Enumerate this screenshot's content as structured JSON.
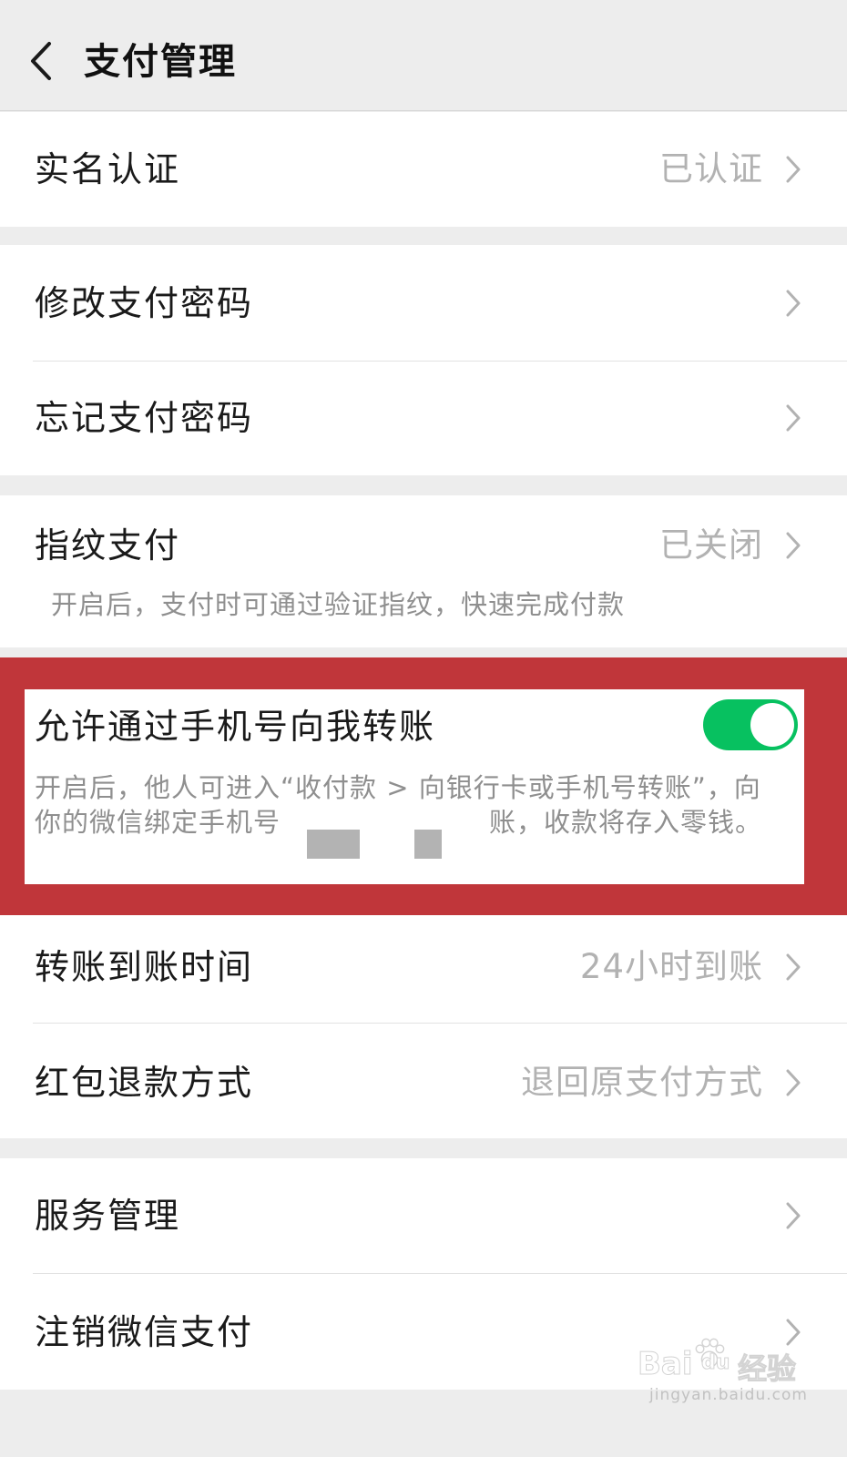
{
  "header": {
    "title": "支付管理",
    "back_icon": "chevron-left-icon"
  },
  "colors": {
    "accent_green": "#07c160",
    "highlight_red": "#c0363a",
    "background": "#ededed",
    "muted_text": "#b2b2b2"
  },
  "groups": {
    "realname": {
      "label": "实名认证",
      "value": "已认证"
    },
    "password": {
      "change_label": "修改支付密码",
      "forgot_label": "忘记支付密码"
    },
    "fingerprint": {
      "label": "指纹支付",
      "value": "已关闭",
      "description": "开启后，支付时可通过验证指纹，快速完成付款"
    },
    "phone_transfer": {
      "label": "允许通过手机号向我转账",
      "enabled": true,
      "description_line1": "开启后，他人可进入“收付款 > 向银行卡或手机号转账”，向",
      "description_line2_start": "你的微信绑定手机号",
      "description_line2_end": "账，收款将存入零钱。"
    },
    "transfer_settings": {
      "arrival_label": "转账到账时间",
      "arrival_value": "24小时到账",
      "refund_label": "红包退款方式",
      "refund_value": "退回原支付方式"
    },
    "services": {
      "service_label": "服务管理",
      "cancel_label": "注销微信支付"
    }
  },
  "watermark": {
    "brand_a": "Bai",
    "brand_b": "du",
    "brand_c": "经验",
    "url": "jingyan.baidu.com"
  }
}
